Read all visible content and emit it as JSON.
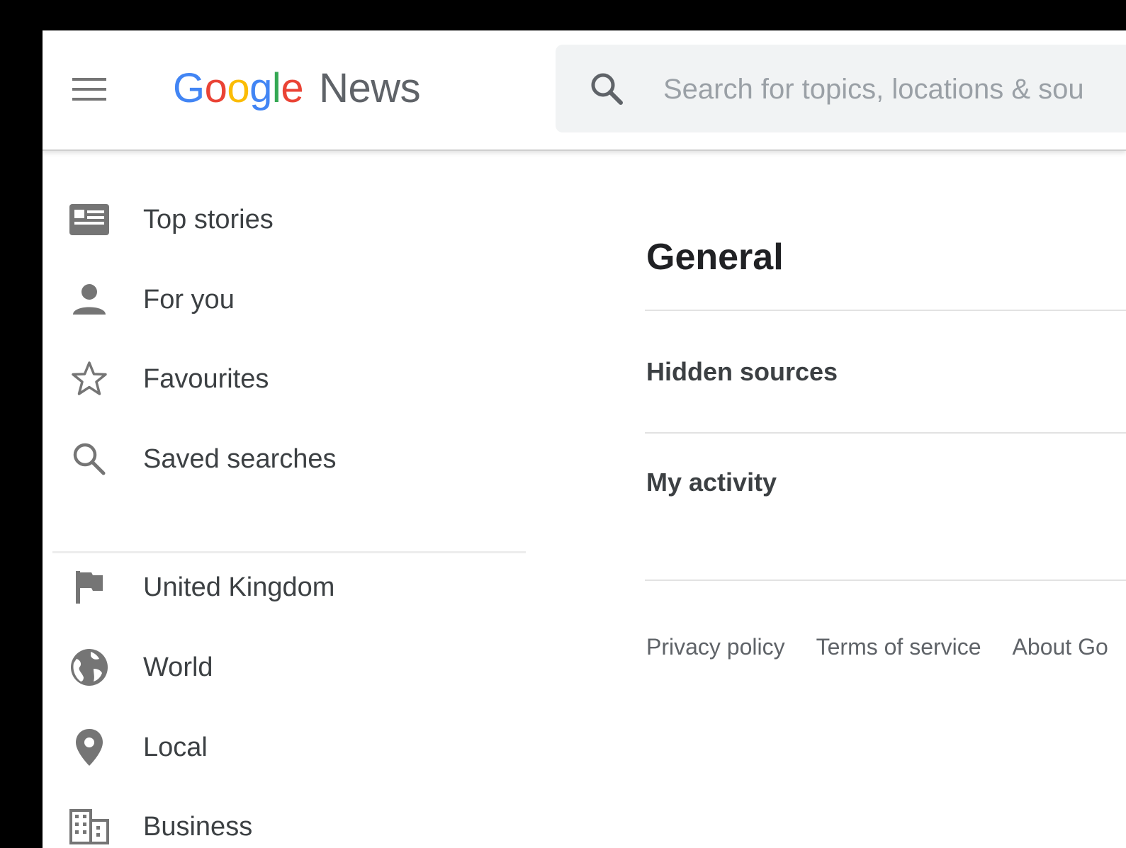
{
  "header": {
    "menu_icon": "hamburger-menu-icon",
    "logo": {
      "letters": [
        "G",
        "o",
        "o",
        "g",
        "l",
        "e"
      ],
      "product": "News"
    },
    "search": {
      "icon": "search-icon",
      "placeholder": "Search for topics, locations & sou",
      "value": ""
    }
  },
  "sidebar": {
    "items": [
      {
        "label": "Top stories",
        "icon": "newspaper-icon"
      },
      {
        "label": "For you",
        "icon": "person-icon"
      },
      {
        "label": "Favourites",
        "icon": "star-outline-icon"
      },
      {
        "label": "Saved searches",
        "icon": "search-icon"
      },
      {
        "label": "United Kingdom",
        "icon": "flag-icon"
      },
      {
        "label": "World",
        "icon": "globe-icon"
      },
      {
        "label": "Local",
        "icon": "location-pin-icon"
      },
      {
        "label": "Business",
        "icon": "building-icon"
      }
    ]
  },
  "main": {
    "title": "General",
    "rows": [
      {
        "label": "Hidden sources"
      },
      {
        "label": "My activity"
      }
    ],
    "footer_links": [
      "Privacy policy",
      "Terms of service",
      "About Go"
    ]
  },
  "colors": {
    "google_blue": "#4285F4",
    "google_red": "#EA4335",
    "google_yellow": "#FBBC05",
    "google_green": "#34A853",
    "icon_gray": "#757575",
    "text_dark": "#3c4043"
  }
}
